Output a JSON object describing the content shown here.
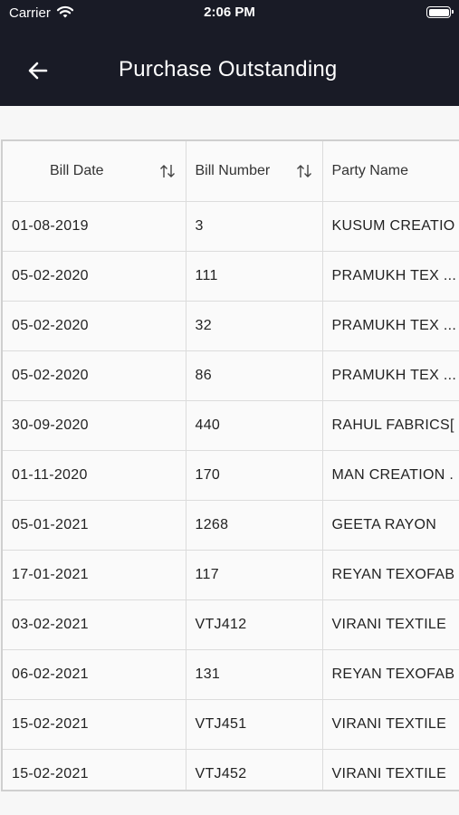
{
  "status_bar": {
    "carrier": "Carrier",
    "time": "2:06 PM"
  },
  "header": {
    "title": "Purchase Outstanding"
  },
  "table": {
    "columns": [
      "Bill Date",
      "Bill Number",
      "Party Name"
    ],
    "rows": [
      [
        "01-08-2019",
        "3",
        "KUSUM CREATIO"
      ],
      [
        "05-02-2020",
        "111",
        "PRAMUKH TEX ..."
      ],
      [
        "05-02-2020",
        "32",
        "PRAMUKH TEX ..."
      ],
      [
        "05-02-2020",
        "86",
        "PRAMUKH TEX ..."
      ],
      [
        "30-09-2020",
        "440",
        "RAHUL FABRICS["
      ],
      [
        "01-11-2020",
        "170",
        "MAN CREATION ."
      ],
      [
        "05-01-2021",
        "1268",
        "GEETA RAYON"
      ],
      [
        "17-01-2021",
        "117",
        "REYAN TEXOFAB"
      ],
      [
        "03-02-2021",
        "VTJ412",
        "VIRANI TEXTILE"
      ],
      [
        "06-02-2021",
        "131",
        "REYAN TEXOFAB"
      ],
      [
        "15-02-2021",
        "VTJ451",
        "VIRANI TEXTILE"
      ],
      [
        "15-02-2021",
        "VTJ452",
        "VIRANI TEXTILE"
      ]
    ]
  },
  "icons": {
    "back": "arrow-left-icon",
    "sort": "sort-arrows-icon",
    "wifi": "wifi-icon",
    "battery": "battery-icon"
  }
}
